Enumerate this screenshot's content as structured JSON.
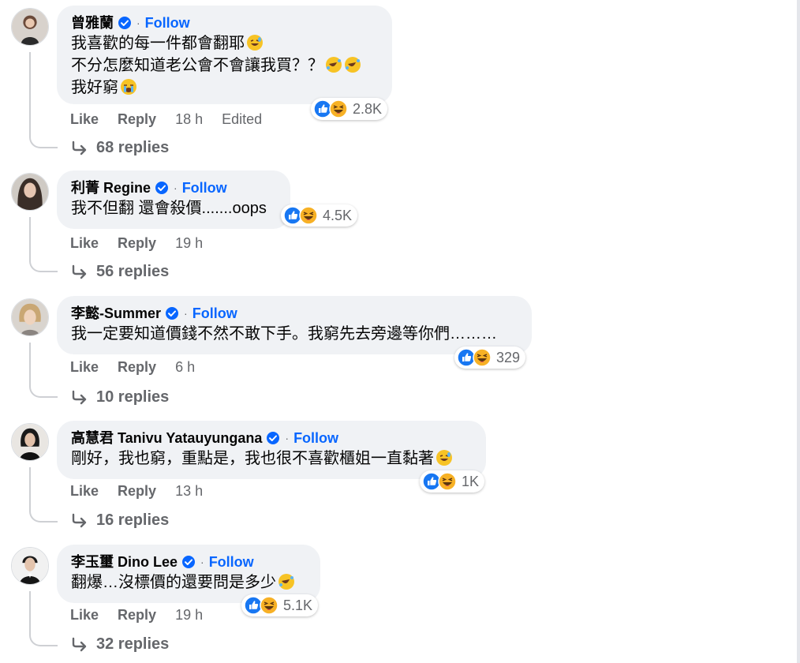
{
  "ui": {
    "follow_label": "Follow",
    "like_label": "Like",
    "reply_label": "Reply",
    "edited_label": "Edited"
  },
  "comments": [
    {
      "author": "曾雅蘭",
      "lines": [
        "我喜歡的每一件都會翻耶",
        "不分怎麼知道老公會不會讓我買？？",
        "我好窮"
      ],
      "reactions": "2.8K",
      "time": "18 h",
      "edited": true,
      "replies": "68 replies"
    },
    {
      "author": "利菁 Regine",
      "lines": [
        "我不但翻 還會殺價.......oops"
      ],
      "reactions": "4.5K",
      "time": "19 h",
      "replies": "56 replies"
    },
    {
      "author": "李懿-Summer",
      "lines": [
        "我一定要知道價錢不然不敢下手。我窮先去旁邊等你們………"
      ],
      "reactions": "329",
      "time": "6 h",
      "replies": "10 replies"
    },
    {
      "author": "高慧君 Tanivu Yatauyungana",
      "lines": [
        "剛好，我也窮，重點是，我也很不喜歡櫃姐一直黏著"
      ],
      "reactions": "1K",
      "time": "13 h",
      "replies": "16 replies"
    },
    {
      "author": "李玉璽 Dino Lee",
      "lines": [
        "翻爆…沒標價的還要問是多少"
      ],
      "reactions": "5.1K",
      "time": "19 h",
      "replies": "32 replies"
    }
  ],
  "colors": {
    "link": "#0866ff",
    "secondary_text": "#65676b",
    "bubble": "#f0f2f5",
    "like_blue": "#1877f2",
    "haha_yellow": "#f7b125"
  }
}
